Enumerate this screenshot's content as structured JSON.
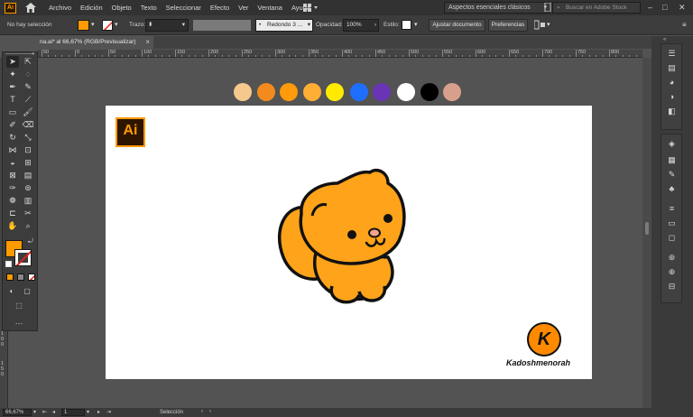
{
  "app": {
    "logo_text": "Ai"
  },
  "menu": [
    "Archivo",
    "Edición",
    "Objeto",
    "Texto",
    "Seleccionar",
    "Efecto",
    "Ver",
    "Ventana",
    "Ayuda"
  ],
  "workspace": {
    "label": "Aspectos esenciales clásicos"
  },
  "stock_search": {
    "placeholder": "Buscar en Adobe Stock"
  },
  "control_bar": {
    "selection_label": "No hay selección",
    "stroke_label": "Trazo:",
    "brush_label": "Redondo 3 ...",
    "opacity_label": "Opacidad:",
    "opacity_value": "100%",
    "style_label": "Estilo:",
    "align_doc_button": "Ajustar documento",
    "preferences_button": "Preferencias"
  },
  "document_tab": {
    "title": "na.ai* al 66,67% (RGB/Previsualizar)"
  },
  "ruler": {
    "top_labels": [
      "50",
      "0",
      "50",
      "100",
      "150",
      "200",
      "250",
      "300",
      "350",
      "400",
      "450",
      "500",
      "550",
      "600",
      "650",
      "700",
      "750",
      "800",
      "850",
      "900"
    ],
    "left_labels": [
      "1",
      "0",
      "0",
      "1",
      "5",
      "0"
    ]
  },
  "swatches": [
    "#f5c98e",
    "#f28a1e",
    "#ff9a0a",
    "#ffae35",
    "#ffea00",
    "#1f6fff",
    "#6a35b5",
    "#ffffff",
    "#000000",
    "#d8a08c"
  ],
  "artboard": {
    "badge_text": "Ai",
    "watermark_letter": "K",
    "watermark_name": "Kadoshmenorah"
  },
  "colors": {
    "fill": "#ff9a00",
    "cat_body": "#ffa31a",
    "accent": "#ff9a00"
  },
  "status_bar": {
    "zoom": "66,67%",
    "artboard_number": "1",
    "status_text": "Selección"
  }
}
